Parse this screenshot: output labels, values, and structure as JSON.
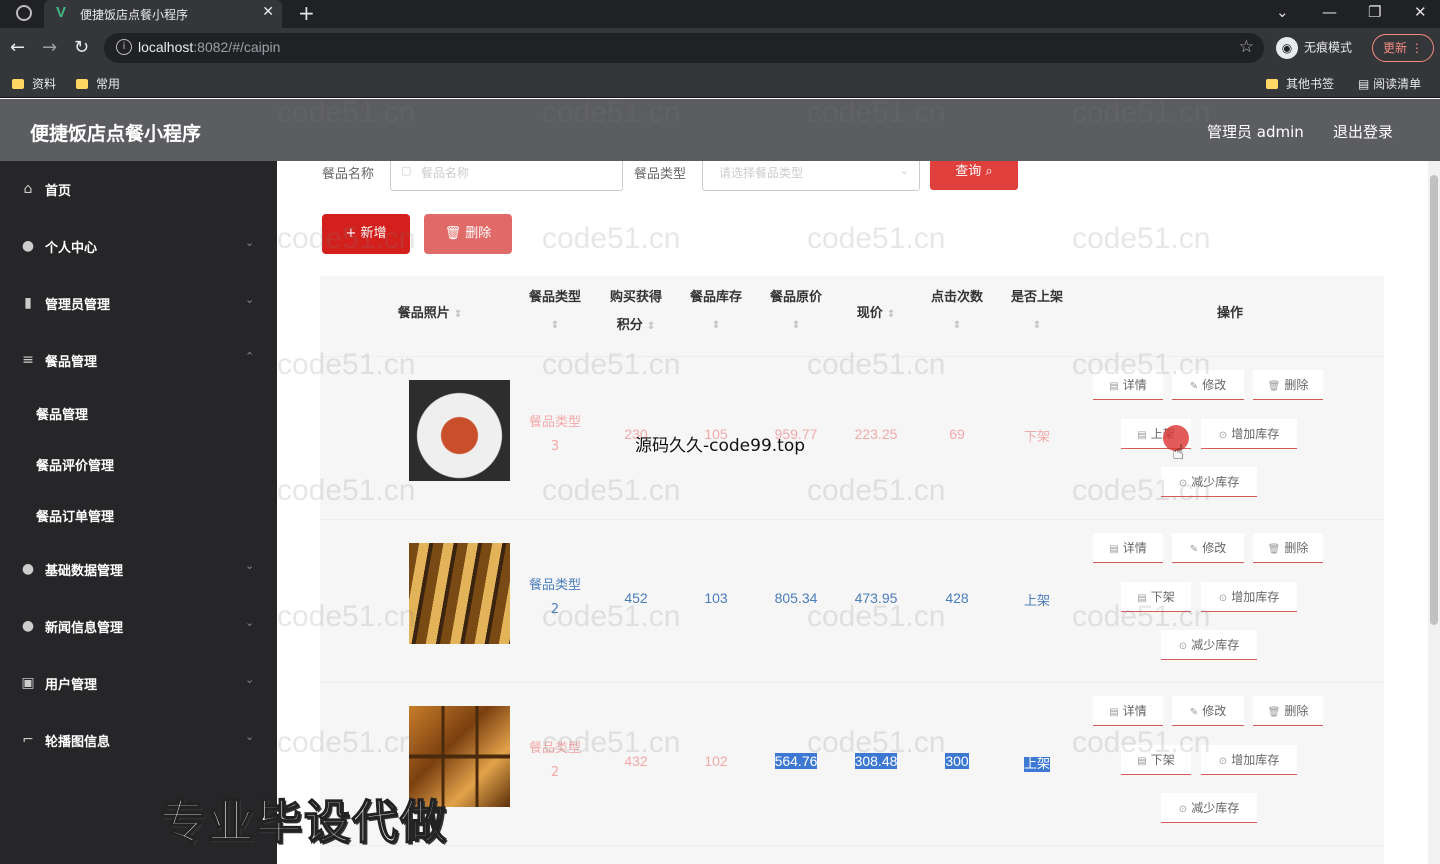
{
  "browser": {
    "tab_title": "便捷饭店点餐小程序",
    "tab_favicon": "V",
    "url_host": "localhost",
    "url_rest": ":8082/#/caipin",
    "incognito_label": "无痕模式",
    "update_label": "更新",
    "bookmarks": [
      "资料",
      "常用"
    ],
    "other_bookmarks": "其他书签",
    "reading_list": "阅读清单"
  },
  "header": {
    "title": "便捷饭店点餐小程序",
    "user": "管理员 admin",
    "logout": "退出登录"
  },
  "sidebar": {
    "items": [
      {
        "label": "首页",
        "icon": "home-icon"
      },
      {
        "label": "个人中心",
        "icon": "user-icon"
      },
      {
        "label": "管理员管理",
        "icon": "chart-icon"
      },
      {
        "label": "餐品管理",
        "icon": "menu-icon"
      },
      {
        "label": "基础数据管理",
        "icon": "user-icon"
      },
      {
        "label": "新闻信息管理",
        "icon": "location-icon"
      },
      {
        "label": "用户管理",
        "icon": "calendar-icon"
      },
      {
        "label": "轮播图信息",
        "icon": "crop-icon"
      }
    ],
    "sub_items": [
      "餐品管理",
      "餐品评价管理",
      "餐品订单管理"
    ]
  },
  "search": {
    "name_label": "餐品名称",
    "name_placeholder": "餐品名称",
    "type_label": "餐品类型",
    "type_placeholder": "请选择餐品类型",
    "query_label": "查询 ⌕"
  },
  "actions": {
    "add_label": "+ 新增",
    "delete_label": "🗑 删除"
  },
  "table": {
    "headers": {
      "photo": "餐品照片",
      "type": "餐品类型",
      "points_1": "购买获得",
      "points_2": "积分",
      "stock": "餐品库存",
      "orig_price": "餐品原价",
      "price": "现价",
      "clicks": "点击次数",
      "on_shelf": "是否上架",
      "ops": "操作"
    },
    "rows": [
      {
        "type_1": "餐品类型",
        "type_2": "3",
        "points": "230",
        "stock": "105",
        "orig_price": "959.77",
        "price": "223.25",
        "clicks": "69",
        "on_shelf": "下架",
        "toggle": "上架"
      },
      {
        "type_1": "餐品类型",
        "type_2": "2",
        "points": "452",
        "stock": "103",
        "orig_price": "805.34",
        "price": "473.95",
        "clicks": "428",
        "on_shelf": "上架",
        "toggle": "下架"
      },
      {
        "type_1": "餐品类型",
        "type_2": "2",
        "points": "432",
        "stock": "102",
        "orig_price": "564.76",
        "price": "308.48",
        "clicks": "300",
        "on_shelf": "上架",
        "toggle": "下架"
      }
    ],
    "op_labels": {
      "detail": "详情",
      "edit": "修改",
      "delete": "删除",
      "add_stock": "增加库存",
      "reduce_stock": "减少库存"
    }
  },
  "overlays": {
    "watermark": "code51.cn",
    "center_text": "源码久久-code99.top",
    "big_text": "专业毕设代做"
  },
  "colors": {
    "accent": "#d3201d",
    "sidebar_bg": "#262628",
    "header_bg": "#5c5d60",
    "selection": "#3d79d3"
  }
}
